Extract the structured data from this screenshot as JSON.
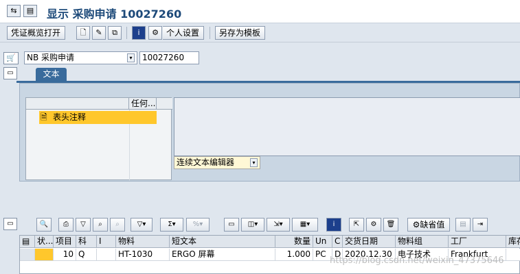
{
  "title": "显示 采购申请 10027260",
  "toolbar": {
    "doc_overview_label": "凭证概览打开",
    "personal_settings_label": "个人设置",
    "save_as_template_label": "另存为模板"
  },
  "header": {
    "doc_type_value": "NB 采购申请",
    "doc_number": "10027260"
  },
  "tabs": [
    {
      "label": "文本"
    }
  ],
  "text_panel": {
    "columns": [
      "",
      "任何..."
    ],
    "rows": [
      {
        "label": "表头注释",
        "icon": "document-icon"
      }
    ],
    "editor_mode": "连续文本编辑器"
  },
  "items_toolbar": {
    "default_value_label": "缺省值"
  },
  "items_table": {
    "headers": [
      "",
      "状...",
      "项目",
      "科",
      "I",
      "物料",
      "短文本",
      "数量",
      "Un",
      "C",
      "交货日期",
      "物料组",
      "工厂",
      "库存"
    ],
    "rows": [
      {
        "status": "",
        "item": "10",
        "account": "Q",
        "i": "",
        "material": "HT-1030",
        "short_text": "ERGO 屏幕",
        "quantity": "1.000",
        "unit": "PC",
        "c": "D",
        "delivery_date": "2020.12.30",
        "material_group": "电子技术",
        "plant": "Frankfurt",
        "storage": ""
      }
    ]
  },
  "watermark": "https://blog.csdn.net/weixin_47375646",
  "colors": {
    "accent": "#396b9c",
    "highlight": "#ffc72c",
    "title": "#1d4a7a"
  }
}
